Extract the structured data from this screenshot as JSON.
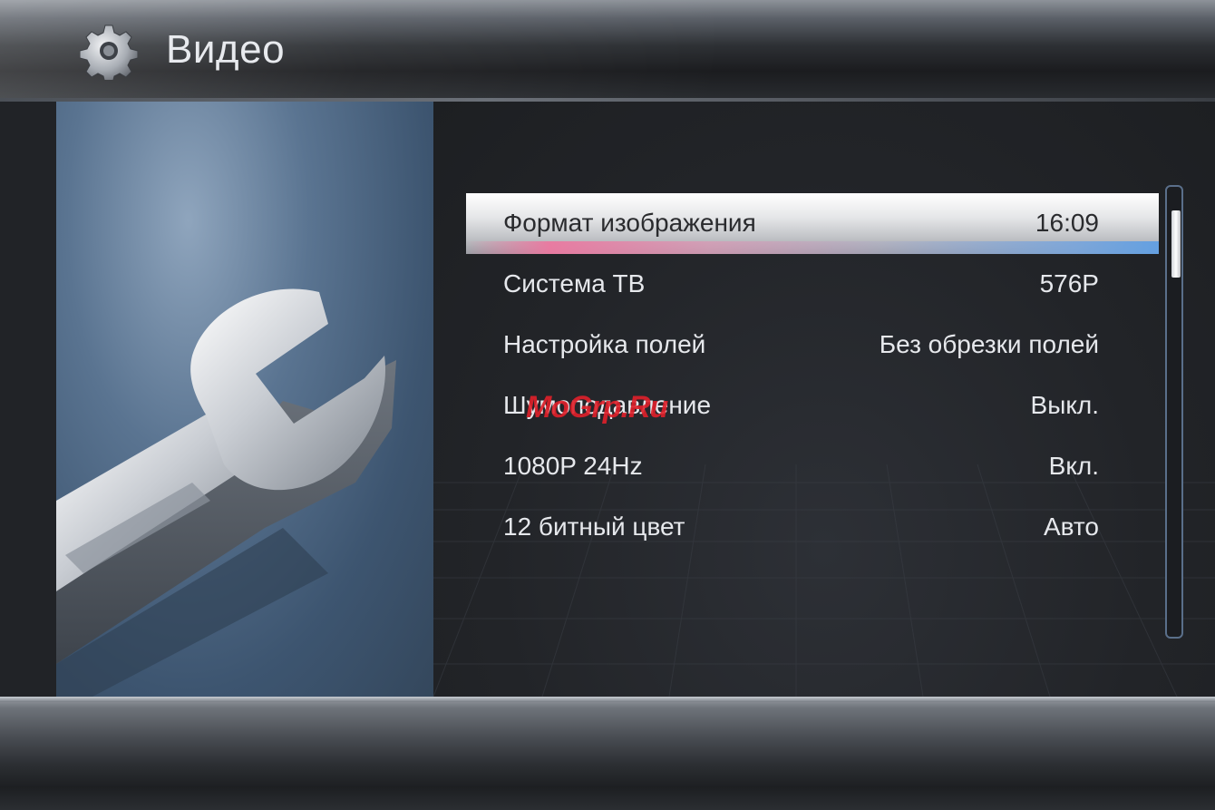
{
  "header": {
    "title": "Видео",
    "icon": "gear-icon"
  },
  "menu": {
    "items": [
      {
        "label": "Формат изображения",
        "value": "16:09",
        "selected": true
      },
      {
        "label": "Система ТВ",
        "value": "576P",
        "selected": false
      },
      {
        "label": "Настройка полей",
        "value": "Без обрезки полей",
        "selected": false
      },
      {
        "label": "Шумоподавление",
        "value": "Выкл.",
        "selected": false
      },
      {
        "label": "1080P 24Hz",
        "value": "Вкл.",
        "selected": false
      },
      {
        "label": "12 битный цвет",
        "value": "Авто",
        "selected": false
      }
    ]
  },
  "watermark": "MoGrp.Ru",
  "art": {
    "icon": "wrench-icon"
  },
  "colors": {
    "selection_glow_left": "#eb78a0",
    "selection_glow_right": "#64a0e1",
    "panel_blue": "#5a7491",
    "scroll_border": "#5a6f8a"
  }
}
